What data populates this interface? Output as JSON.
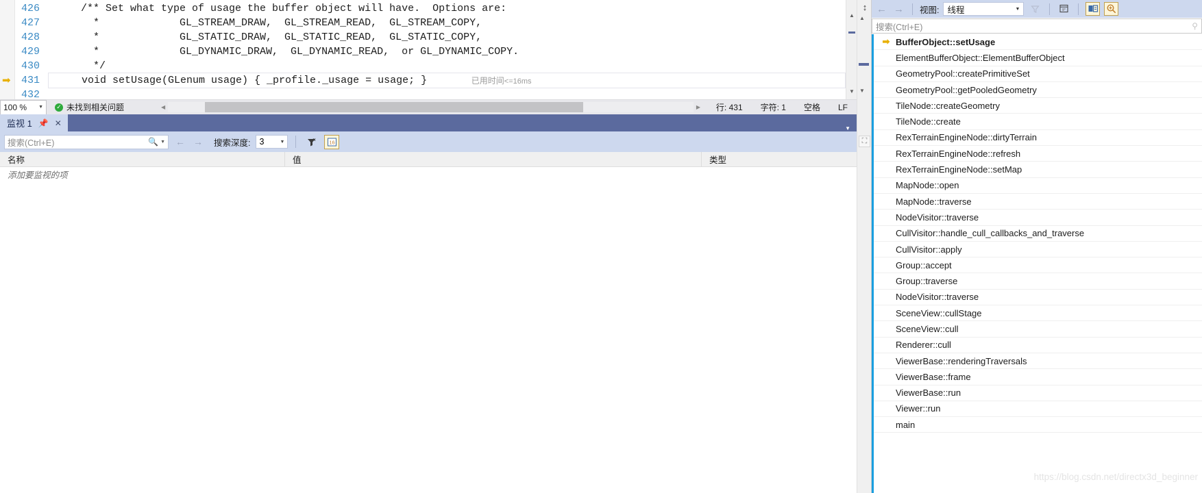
{
  "editor": {
    "lines": [
      {
        "num": "426",
        "text": "    /** Set what type of usage the buffer object will have.  Options are:"
      },
      {
        "num": "427",
        "text": "      *             GL_STREAM_DRAW,  GL_STREAM_READ,  GL_STREAM_COPY,"
      },
      {
        "num": "428",
        "text": "      *             GL_STATIC_DRAW,  GL_STATIC_READ,  GL_STATIC_COPY,"
      },
      {
        "num": "429",
        "text": "      *             GL_DYNAMIC_DRAW,  GL_DYNAMIC_READ,  or GL_DYNAMIC_COPY."
      },
      {
        "num": "430",
        "text": "      */"
      },
      {
        "num": "431",
        "text": "    void setUsage(GLenum usage) { _profile._usage = usage; }"
      },
      {
        "num": "432",
        "text": ""
      }
    ],
    "current_line_index": 5,
    "elapsed_label": "已用时间",
    "elapsed_op": "<=",
    "elapsed_value": "16ms"
  },
  "status_bar": {
    "zoom": "100 %",
    "issues": "未找到相关问题",
    "line": "行: 431",
    "char": "字符: 1",
    "spaces": "空格",
    "eol": "LF"
  },
  "watch": {
    "tab_label": "监视 1",
    "pin_icon": "pin-icon",
    "close_icon": "close-icon",
    "search_placeholder": "搜索(Ctrl+E)",
    "search_value": "",
    "depth_label": "搜索深度:",
    "depth_value": "3",
    "columns": [
      "名称",
      "值",
      "类型"
    ],
    "empty_row": "添加要监视的项"
  },
  "call_stack": {
    "view_label": "视图:",
    "view_value": "线程",
    "search_placeholder": "搜索(Ctrl+E)",
    "frames": [
      {
        "label": "BufferObject::setUsage",
        "current": true
      },
      {
        "label": "ElementBufferObject::ElementBufferObject",
        "current": false
      },
      {
        "label": "GeometryPool::createPrimitiveSet",
        "current": false
      },
      {
        "label": "GeometryPool::getPooledGeometry",
        "current": false
      },
      {
        "label": "TileNode::createGeometry",
        "current": false
      },
      {
        "label": "TileNode::create",
        "current": false
      },
      {
        "label": "RexTerrainEngineNode::dirtyTerrain",
        "current": false
      },
      {
        "label": "RexTerrainEngineNode::refresh",
        "current": false
      },
      {
        "label": "RexTerrainEngineNode::setMap",
        "current": false
      },
      {
        "label": "MapNode::open",
        "current": false
      },
      {
        "label": "MapNode::traverse",
        "current": false
      },
      {
        "label": "NodeVisitor::traverse",
        "current": false
      },
      {
        "label": "CullVisitor::handle_cull_callbacks_and_traverse",
        "current": false
      },
      {
        "label": "CullVisitor::apply",
        "current": false
      },
      {
        "label": "Group::accept",
        "current": false
      },
      {
        "label": "Group::traverse",
        "current": false
      },
      {
        "label": "NodeVisitor::traverse",
        "current": false
      },
      {
        "label": "SceneView::cullStage",
        "current": false
      },
      {
        "label": "SceneView::cull",
        "current": false
      },
      {
        "label": "Renderer::cull",
        "current": false
      },
      {
        "label": "ViewerBase::renderingTraversals",
        "current": false
      },
      {
        "label": "ViewerBase::frame",
        "current": false
      },
      {
        "label": "ViewerBase::run",
        "current": false
      },
      {
        "label": "Viewer::run",
        "current": false
      },
      {
        "label": "main",
        "current": false
      }
    ]
  },
  "watermark": "https://blog.csdn.net/directx3d_beginner",
  "colors": {
    "accent_blue": "#5b6a9e",
    "toolbar_blue": "#cdd8ee",
    "line_number": "#3a8ac4",
    "stack_rail": "#1a9fe0",
    "breakpoint_arrow": "#e8b000"
  }
}
